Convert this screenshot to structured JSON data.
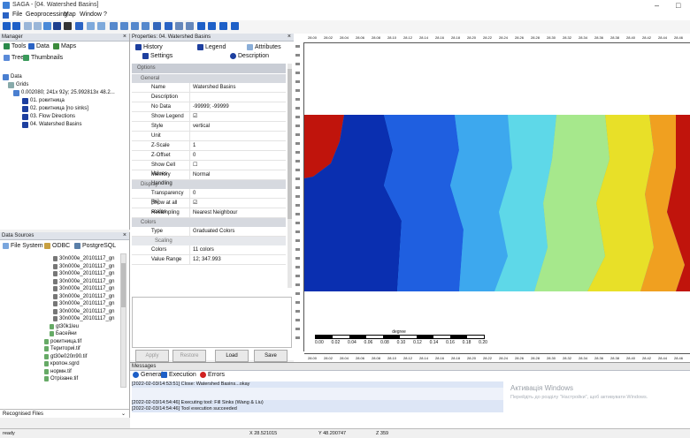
{
  "window": {
    "title": "SAGA - [04. Watershed Basins]",
    "controls": [
      "–",
      "□"
    ]
  },
  "menu": [
    "File",
    "Geoprocessing",
    "Map",
    "Window",
    "?"
  ],
  "manager": {
    "title": "Manager",
    "tabs": [
      "Tools",
      "Data",
      "Maps"
    ],
    "subtabs": [
      "Tree",
      "Thumbnails"
    ],
    "tree": {
      "root": "Data",
      "group": "Grids",
      "system": "0.002080; 241x 92y; 25.992813x 48.2...",
      "items": [
        "01. рокитница",
        "02. рокитница [no sinks]",
        "03. Flow Directions",
        "04. Watershed Basins"
      ]
    }
  },
  "datasources": {
    "title": "Data Sources",
    "tabs": [
      "File System",
      "ODBC",
      "PostgreSQL"
    ],
    "files": [
      "30n000e_20101117_gn",
      "30n000e_20101117_gn",
      "30n000e_20101117_gn",
      "30n000e_20101117_gn",
      "30n000e_20101117_gn",
      "30n000e_20101117_gn",
      "30n000e_20101117_gn",
      "30n000e_20101117_gn",
      "30n000e_20101117_gn"
    ],
    "extra": [
      "gt30k1leu",
      "Басейни",
      "рокитница.tif",
      "Териториі.tif",
      "gt30e020n90.tif",
      "кропон.sgrd",
      "нормн.tif",
      "Отрізане.tif"
    ],
    "footer": "Recognised Files"
  },
  "properties": {
    "title": "Properties: 04. Watershed Basins",
    "tabs": [
      "History",
      "Legend",
      "Attributes",
      "Settings",
      "Description"
    ],
    "section": "Options",
    "categories": {
      "general": "General",
      "display": "Display",
      "colors": "Colors",
      "scaling": "Scaling"
    },
    "general": [
      {
        "k": "Name",
        "v": "Watershed Basins"
      },
      {
        "k": "Description",
        "v": ""
      },
      {
        "k": "No Data",
        "v": "-99999; -99999"
      },
      {
        "k": "Show Legend",
        "v": "☑"
      },
      {
        "k": "Style",
        "v": "vertical"
      },
      {
        "k": "Unit",
        "v": ""
      },
      {
        "k": "Z-Scale",
        "v": "1"
      },
      {
        "k": "Z-Offset",
        "v": "0"
      },
      {
        "k": "Show Cell Values",
        "v": "☐"
      },
      {
        "k": "Memory Handling",
        "v": "Normal"
      }
    ],
    "display": [
      {
        "k": "Transparency [%]",
        "v": "0"
      },
      {
        "k": "Show at all scales",
        "v": "☑"
      },
      {
        "k": "Resampling",
        "v": "Nearest Neighbour"
      }
    ],
    "colors": [
      {
        "k": "Type",
        "v": "Graduated Colors"
      }
    ],
    "scaling": [
      {
        "k": "Colors",
        "v": "11 colors"
      },
      {
        "k": "Value Range",
        "v": "12; 347.993"
      }
    ],
    "buttons": [
      "Apply",
      "Restore",
      "Load",
      "Save"
    ]
  },
  "map": {
    "top_ticks": [
      "28.00",
      "28.02",
      "28.04",
      "28.06",
      "28.08",
      "28.10",
      "28.12",
      "28.14",
      "28.16",
      "28.18",
      "28.20",
      "28.22",
      "28.24",
      "28.26",
      "28.28",
      "28.30",
      "28.32",
      "28.34",
      "28.36",
      "28.38",
      "28.40",
      "28.42",
      "28.44",
      "28.46"
    ],
    "scalebar_label": "degree",
    "scalebar_ticks": [
      "0.00",
      "0.02",
      "0.04",
      "0.06",
      "0.08",
      "0.10",
      "0.12",
      "0.14",
      "0.16",
      "0.18",
      "0.20"
    ],
    "colors": {
      "red": "#c0140c",
      "blue_dark": "#0a2fb0",
      "blue": "#1f5fe0",
      "blue_light": "#3da8ee",
      "cyan": "#5ed8e8",
      "green_light": "#a6e88c",
      "yellow": "#e8e028",
      "orange": "#f0a020"
    }
  },
  "messages": {
    "title": "Messages",
    "tabs": [
      "General",
      "Execution",
      "Errors"
    ],
    "lines": [
      "[2022-02-03/14:53:51] Close: Watershed Basins...okay",
      "[2022-02-03/14:54:46] Executing tool: Fill Sinks (Wang & Liu)",
      "[2022-02-03/14:54:46] Tool execution succeeded"
    ],
    "watermark_title": "Активація Windows",
    "watermark_text": "Перейдіть до розділу \"Настройки\", щоб активувати Windows."
  },
  "status": {
    "left": "ready",
    "x": "X 28.521015",
    "y": "Y 48.200747",
    "z": "Z 359"
  }
}
